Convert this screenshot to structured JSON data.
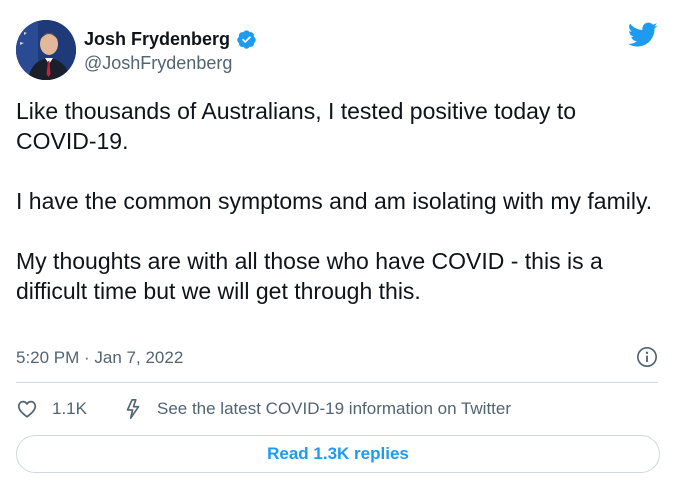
{
  "author": {
    "name": "Josh Frydenberg",
    "handle": "@JoshFrydenberg",
    "verified": true,
    "avatar_icon": "avatar-photo"
  },
  "tweet": {
    "paragraphs": [
      "Like thousands of Australians, I tested positive today to COVID-19.",
      "I have the common symptoms and am isolating with my family.",
      "My thoughts are with all those who have COVID - this is a difficult time but we will get through this."
    ],
    "timestamp": "5:20 PM · Jan 7, 2022"
  },
  "actions": {
    "likes_count": "1.1K",
    "covid_info_label": "See the latest COVID-19 information on Twitter",
    "read_replies_label": "Read 1.3K replies"
  },
  "colors": {
    "brand_blue": "#1d9bf0",
    "text_primary": "#0f1419",
    "text_secondary": "#536471",
    "border": "#cfd9de"
  },
  "icons": {
    "logo": "twitter-bird-icon",
    "verified": "verified-badge-icon",
    "info": "info-icon",
    "like": "heart-icon",
    "covid": "lightning-bolt-icon"
  }
}
